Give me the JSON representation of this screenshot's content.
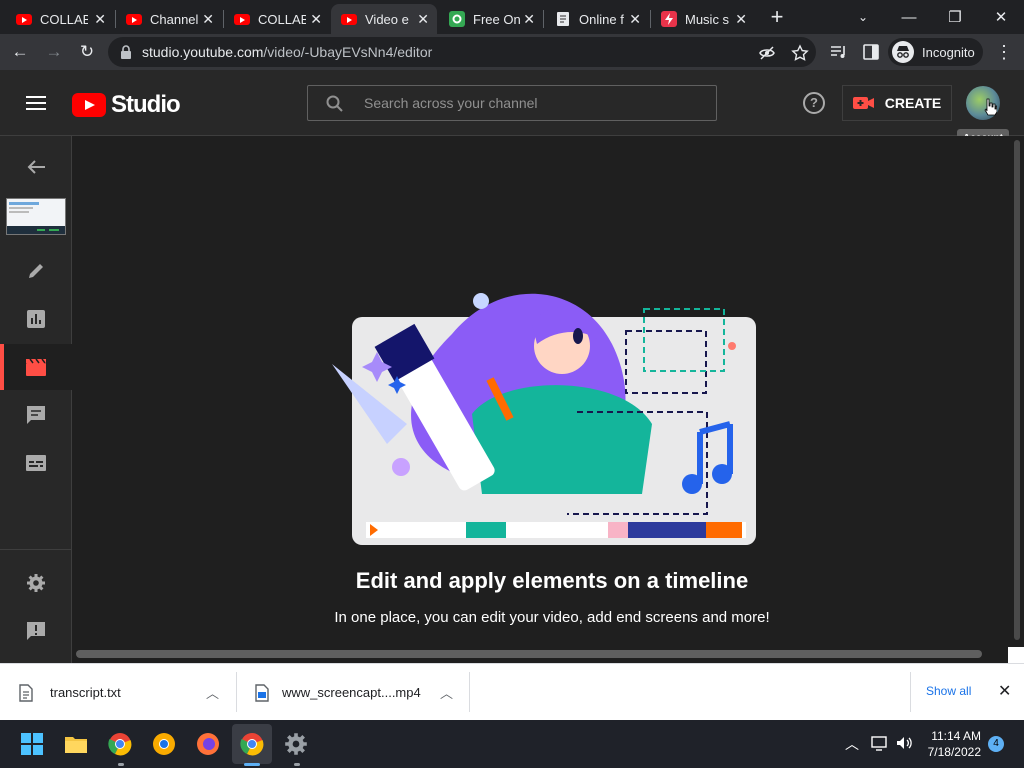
{
  "colors": {
    "brand_red": "#ff0000",
    "accent_red": "#ff4e45",
    "studio_bg": "#282828",
    "content_bg": "#1f1f1f",
    "link_blue": "#1a73e8"
  },
  "browser": {
    "tabs": [
      {
        "title": "COLLAB",
        "icon": "youtube-icon"
      },
      {
        "title": "Channel",
        "icon": "youtube-icon"
      },
      {
        "title": "COLLAB",
        "icon": "youtube-icon"
      },
      {
        "title": "Video e",
        "icon": "youtube-icon"
      },
      {
        "title": "Free On",
        "icon": "green-app-icon"
      },
      {
        "title": "Online f",
        "icon": "document-icon"
      },
      {
        "title": "Music s",
        "icon": "lightning-icon"
      }
    ],
    "active_tab": 3,
    "url_domain": "studio.youtube.com",
    "url_path": "/video/-UbayEVsNn4/editor",
    "incognito_label": "Incognito"
  },
  "header": {
    "logo_text": "Studio",
    "search_placeholder": "Search across your channel",
    "help_glyph": "?",
    "create_label": "CREATE",
    "account_tooltip": "Account"
  },
  "rail": {
    "items": [
      "back-arrow-icon",
      "video-thumbnail",
      "details-pencil-icon",
      "analytics-icon",
      "editor-clapper-icon",
      "comments-icon",
      "subtitles-icon",
      "settings-gear-icon",
      "feedback-icon"
    ],
    "active": "editor-clapper-icon"
  },
  "main": {
    "heading": "Edit and apply elements on a timeline",
    "subheading": "In one place, you can edit your video, add end screens and more!"
  },
  "downloads": {
    "items": [
      {
        "name": "transcript.txt",
        "icon": "text-file-icon"
      },
      {
        "name": "www_screencapt....mp4",
        "icon": "video-file-icon"
      }
    ],
    "show_all": "Show all"
  },
  "taskbar": {
    "apps": [
      "windows-start-icon",
      "file-explorer-icon",
      "chrome-icon",
      "chrome-canary-icon",
      "firefox-icon",
      "chrome-active-icon",
      "settings-icon"
    ],
    "time": "11:14 AM",
    "date": "7/18/2022",
    "notifications": "4"
  }
}
